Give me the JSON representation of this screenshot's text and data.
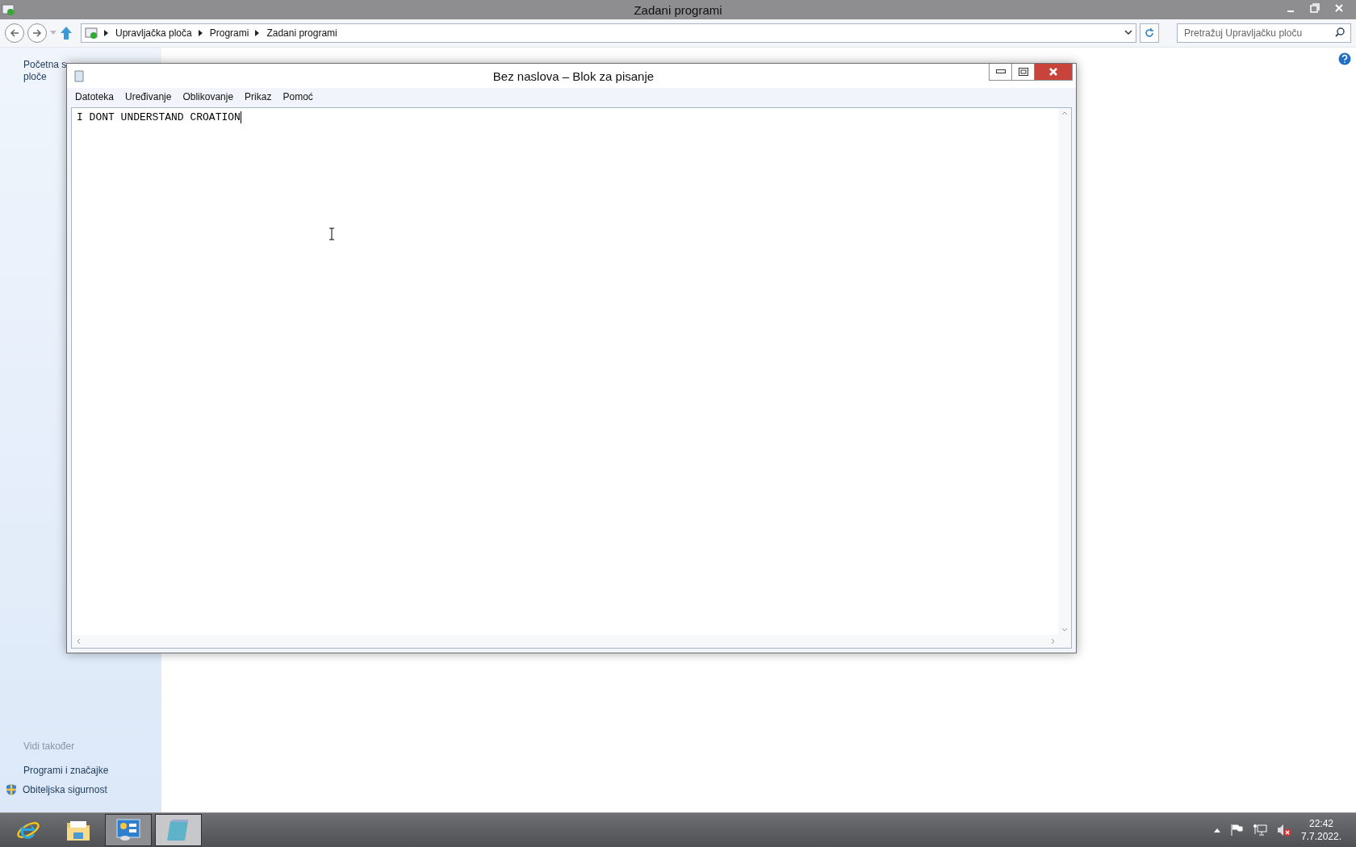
{
  "explorer": {
    "title": "Zadani programi",
    "breadcrumb": [
      "Upravljačka ploča",
      "Programi",
      "Zadani programi"
    ],
    "search": {
      "placeholder": "Pretražuj Upravljačku ploču"
    },
    "sidebar": {
      "home_link": [
        "Početna s",
        "ploče"
      ],
      "see_also_heading": "Vidi također",
      "links": [
        {
          "label": "Programi i značajke",
          "kind": "plain"
        },
        {
          "label": "Obiteljska sigurnost",
          "kind": "shield"
        }
      ]
    }
  },
  "notepad": {
    "title": "Bez naslova – Blok za pisanje",
    "menu": [
      "Datoteka",
      "Uređivanje",
      "Oblikovanje",
      "Prikaz",
      "Pomoć"
    ],
    "text": "I DONT UNDERSTAND CROATION"
  },
  "taskbar": {
    "apps": [
      {
        "kind": "browser",
        "open": false,
        "selected": false
      },
      {
        "kind": "folder",
        "open": false,
        "selected": false
      },
      {
        "kind": "control",
        "open": true,
        "selected": false
      },
      {
        "kind": "notepad",
        "open": true,
        "selected": true
      }
    ],
    "clock": {
      "time": "22:42",
      "date": "7.7.2022."
    }
  }
}
